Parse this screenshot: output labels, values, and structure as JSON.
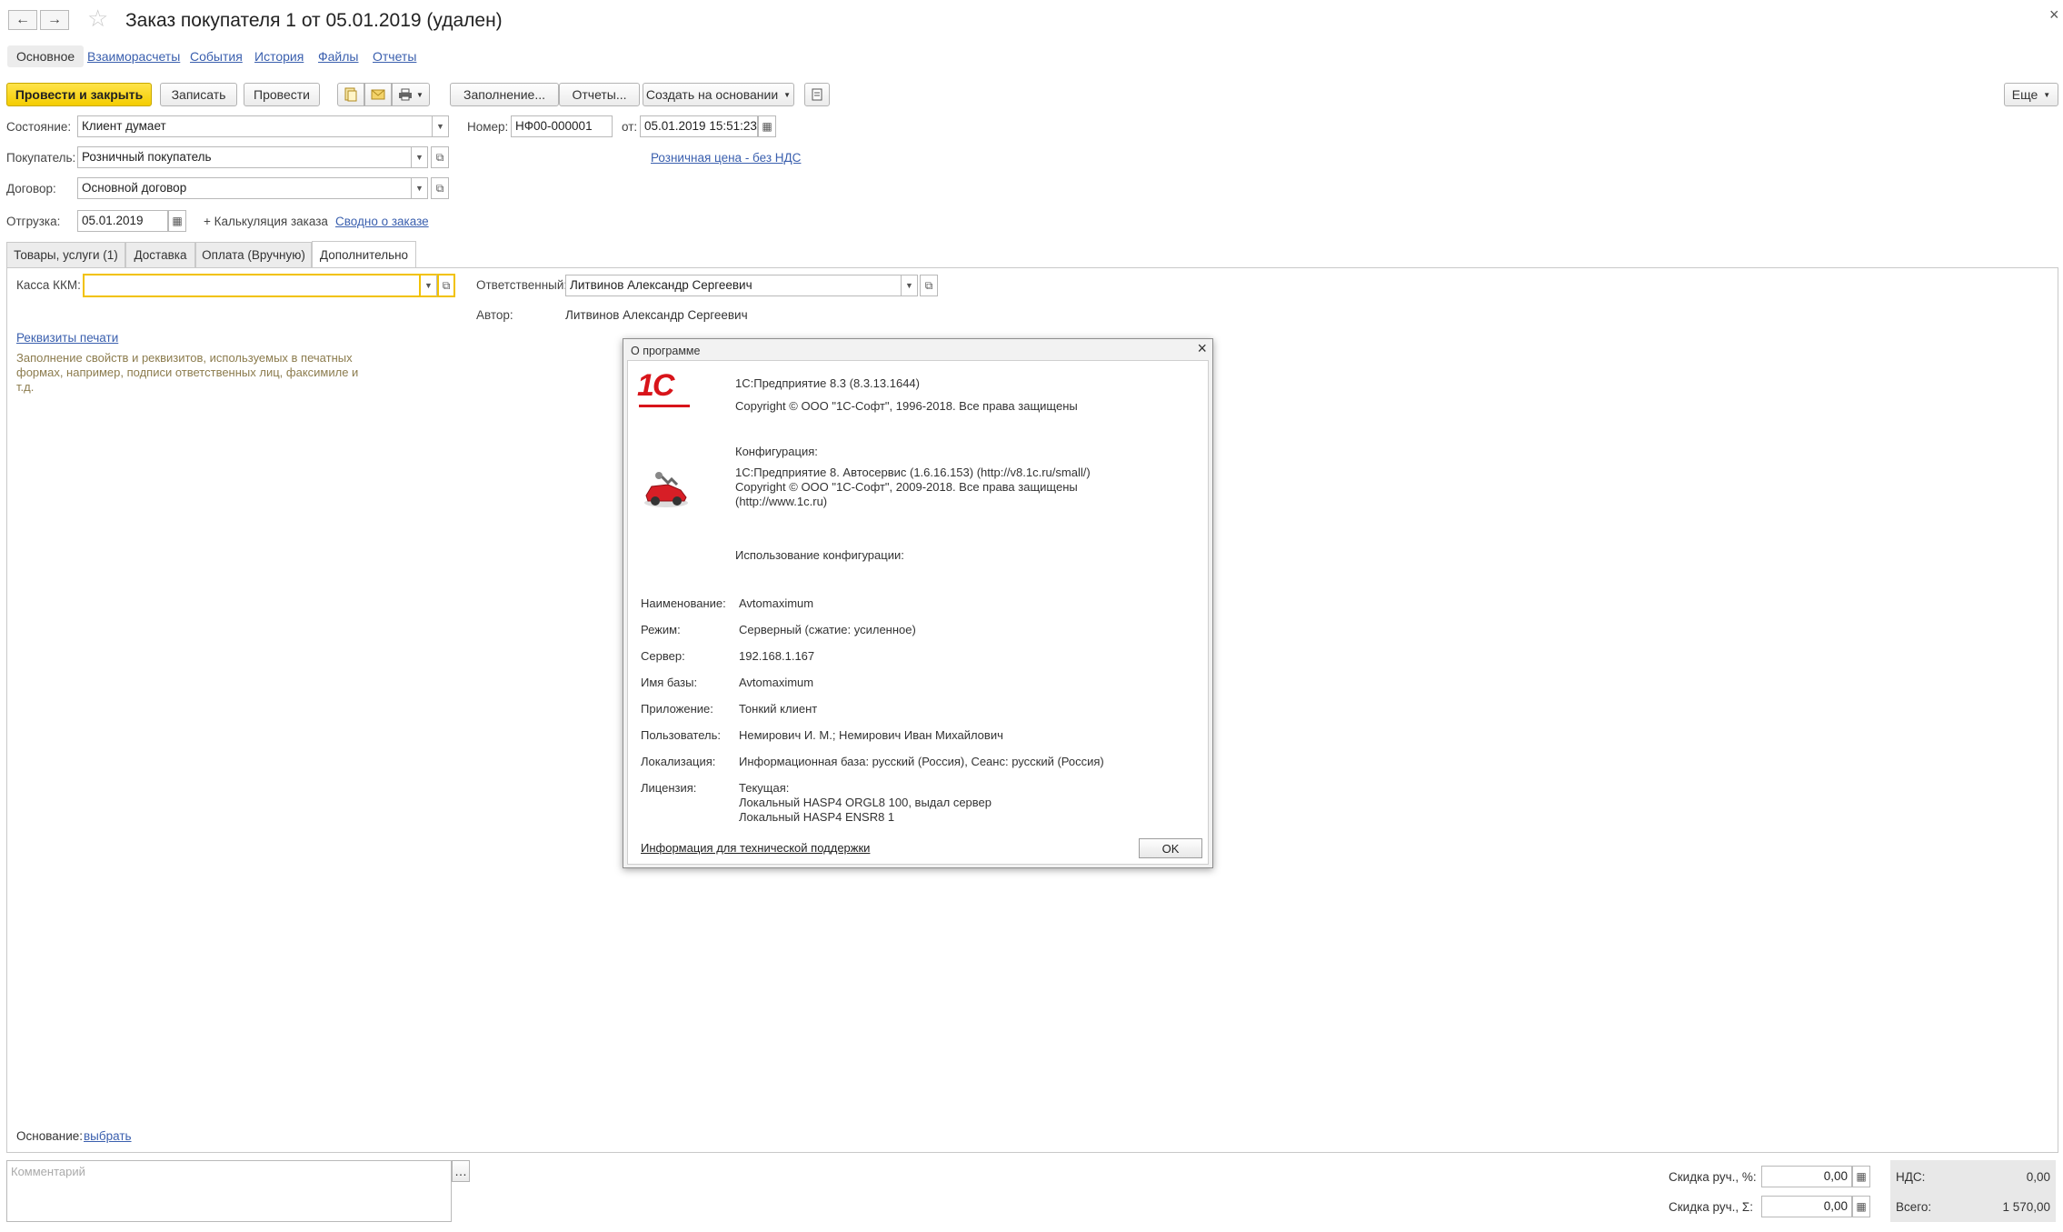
{
  "header": {
    "back_icon": "←",
    "forward_icon": "→",
    "star_icon": "☆",
    "title": "Заказ покупателя 1 от 05.01.2019 (удален)",
    "close_icon": "×"
  },
  "nav_tabs": [
    "Основное",
    "Взаиморасчеты",
    "События",
    "История",
    "Файлы",
    "Отчеты"
  ],
  "toolbar": {
    "post_close": "Провести и закрыть",
    "save": "Записать",
    "post": "Провести",
    "fill": "Заполнение...",
    "reports": "Отчеты...",
    "create_based": "Создать на основании",
    "more": "Еще"
  },
  "form": {
    "state_label": "Состояние:",
    "state_value": "Клиент думает",
    "number_label": "Номер:",
    "number_value": "НФ00-000001",
    "from_label": "от:",
    "date_value": "05.01.2019 15:51:23",
    "price_link": "Розничная цена - без НДС",
    "buyer_label": "Покупатель:",
    "buyer_value": "Розничный покупатель",
    "contract_label": "Договор:",
    "contract_value": "Основной договор",
    "ship_label": "Отгрузка:",
    "ship_value": "05.01.2019",
    "calc_label": "+ Калькуляция заказа",
    "summary_link": "Сводно о заказе"
  },
  "page_tabs": [
    "Товары, услуги (1)",
    "Доставка",
    "Оплата (Вручную)",
    "Дополнительно"
  ],
  "additional": {
    "kkm_label": "Касса ККМ:",
    "kkm_value": "",
    "responsible_label": "Ответственный:",
    "responsible_value": "Литвинов Александр Сергеевич",
    "author_label": "Автор:",
    "author_value": "Литвинов Александр Сергеевич",
    "print_link": "Реквизиты печати",
    "print_hint": "Заполнение свойств и реквизитов, используемых в печатных формах, например, подписи ответственных лиц, факсимиле и т.д.",
    "basis_label": "Основание:",
    "basis_link": "выбрать"
  },
  "dialog": {
    "title": "О программе",
    "logo_text": "1С",
    "platform": "1С:Предприятие 8.3 (8.3.13.1644)",
    "platform_copyright": "Copyright © ООО \"1С-Софт\", 1996-2018. Все права защищены",
    "config_heading": "Конфигурация:",
    "config_name": "1С:Предприятие 8. Автосервис (1.6.16.153) (http://v8.1c.ru/small/)",
    "config_copyright": "Copyright © ООО \"1С-Софт\", 2009-2018. Все права защищены",
    "config_url": "(http://www.1c.ru)",
    "usage_heading": "Использование конфигурации:",
    "rows": [
      {
        "label": "Наименование:",
        "value": "Avtomaximum"
      },
      {
        "label": "Режим:",
        "value": "Серверный (сжатие: усиленное)"
      },
      {
        "label": "Сервер:",
        "value": "192.168.1.167"
      },
      {
        "label": "Имя базы:",
        "value": "Avtomaximum"
      },
      {
        "label": "Приложение:",
        "value": "Тонкий клиент"
      },
      {
        "label": "Пользователь:",
        "value": "Немирович И. М.; Немирович Иван Михайлович"
      },
      {
        "label": "Локализация:",
        "value": "Информационная база: русский (Россия), Сеанс: русский (Россия)"
      }
    ],
    "license_label": "Лицензия:",
    "license_lines": [
      "Текущая:",
      "Локальный HASP4 ORGL8 100, выдал сервер",
      "Локальный HASP4 ENSR8 1"
    ],
    "support_link": "Информация для технической поддержки",
    "ok": "OK"
  },
  "footer": {
    "comment_placeholder": "Комментарий",
    "discount_pct_label": "Скидка руч., %:",
    "discount_pct_value": "0,00",
    "discount_sum_label": "Скидка руч., Σ:",
    "discount_sum_value": "0,00",
    "vat_label": "НДС:",
    "vat_value": "0,00",
    "total_label": "Всего:",
    "total_value": "1 570,00"
  }
}
